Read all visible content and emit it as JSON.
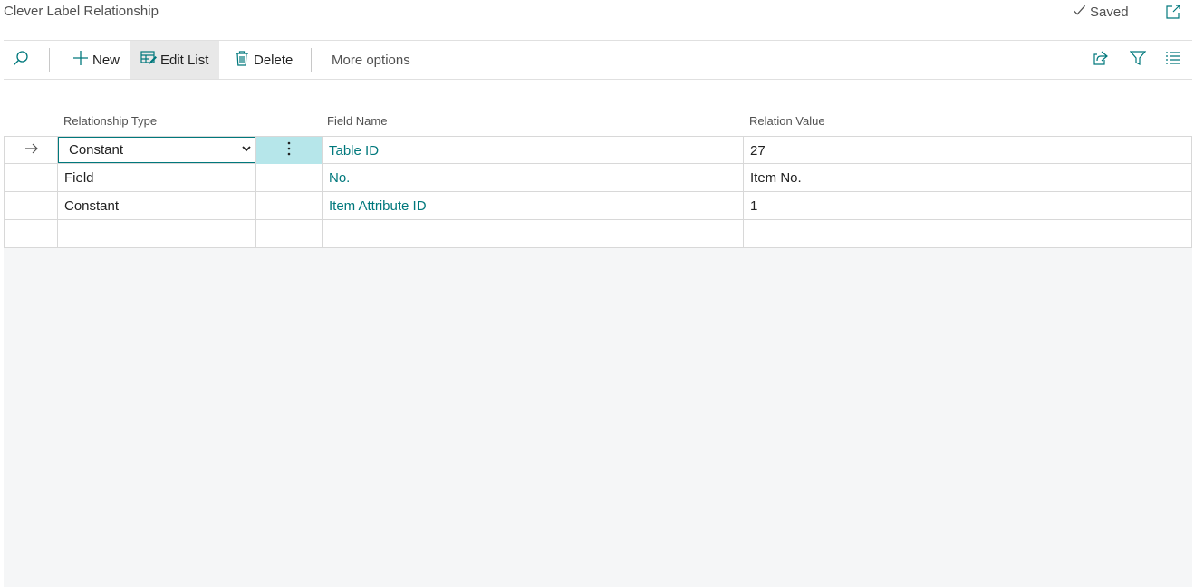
{
  "header": {
    "title": "Clever Label Relationship",
    "saved_label": "Saved"
  },
  "toolbar": {
    "new_label": "New",
    "edit_list_label": "Edit List",
    "delete_label": "Delete",
    "more_options_label": "More options"
  },
  "table": {
    "columns": [
      "Relationship Type",
      "Field Name",
      "Relation Value"
    ],
    "rows": [
      {
        "relationship_type": "Constant",
        "field_name": "Table ID",
        "relation_value": "27"
      },
      {
        "relationship_type": "Field",
        "field_name": "No.",
        "relation_value": "Item No."
      },
      {
        "relationship_type": "Constant",
        "field_name": "Item Attribute ID",
        "relation_value": "1"
      },
      {
        "relationship_type": "",
        "field_name": "",
        "relation_value": ""
      }
    ]
  },
  "colors": {
    "accent": "#00787c",
    "active_cell": "#b6e6ea",
    "grid_background": "#f5f6f7"
  }
}
